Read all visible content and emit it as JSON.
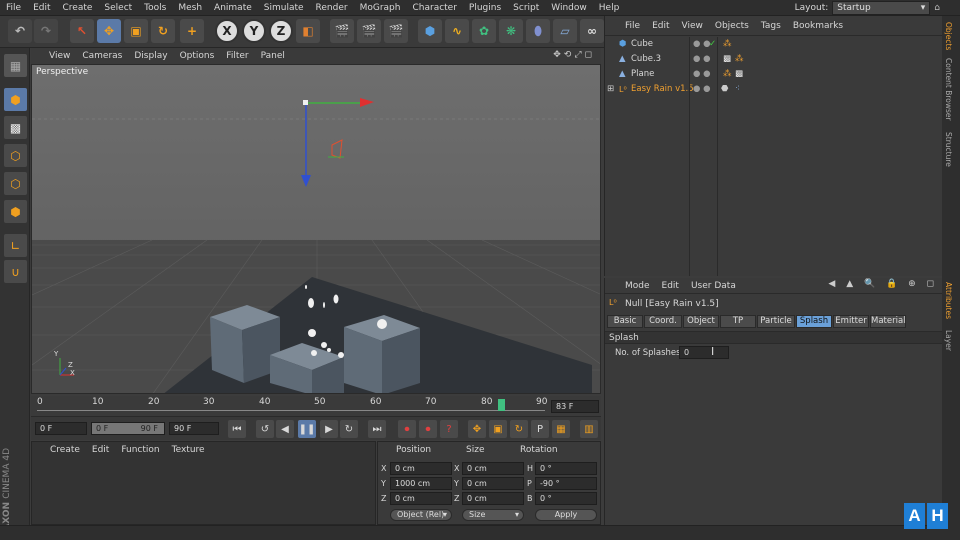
{
  "menubar": {
    "items": [
      "File",
      "Edit",
      "Create",
      "Select",
      "Tools",
      "Mesh",
      "Animate",
      "Simulate",
      "Render",
      "MoGraph",
      "Character",
      "Plugins",
      "Script",
      "Window",
      "Help"
    ],
    "layout_label": "Layout:",
    "layout_value": "Startup"
  },
  "toolbar": {
    "axis_x": "X",
    "axis_y": "Y",
    "axis_z": "Z"
  },
  "viewport": {
    "menu": [
      "View",
      "Cameras",
      "Display",
      "Options",
      "Filter",
      "Panel"
    ],
    "label": "Perspective",
    "axis_labels": {
      "y": "Y",
      "x": "X",
      "z": "Z"
    }
  },
  "timeline": {
    "ticks": [
      "0",
      "10",
      "20",
      "30",
      "40",
      "50",
      "60",
      "70",
      "80",
      "90"
    ],
    "current_frame": "83 F"
  },
  "playbar": {
    "start_frame": "0 F",
    "range_min": "0 F",
    "range_max": "90 F",
    "end_frame": "90 F"
  },
  "material_panel": {
    "menu": [
      "Create",
      "Edit",
      "Function",
      "Texture"
    ]
  },
  "coord_panel": {
    "headers": [
      "Position",
      "Size",
      "Rotation"
    ],
    "rows": [
      {
        "pl": "X",
        "pv": "0 cm",
        "sl": "X",
        "sv": "0 cm",
        "rl": "H",
        "rv": "0 °"
      },
      {
        "pl": "Y",
        "pv": "1000 cm",
        "sl": "Y",
        "sv": "0 cm",
        "rl": "P",
        "rv": "-90 °"
      },
      {
        "pl": "Z",
        "pv": "0 cm",
        "sl": "Z",
        "sv": "0 cm",
        "rl": "B",
        "rv": "0 °"
      }
    ],
    "mode_select": "Object (Rel)",
    "size_select": "Size",
    "apply_label": "Apply"
  },
  "object_panel": {
    "menu": [
      "File",
      "Edit",
      "View",
      "Objects",
      "Tags",
      "Bookmarks"
    ],
    "objects": [
      {
        "name": "Cube",
        "color": "#d8d8d8"
      },
      {
        "name": "Cube.3",
        "color": "#d8d8d8"
      },
      {
        "name": "Plane",
        "color": "#d8d8d8"
      },
      {
        "name": "Easy Rain v1.5",
        "color": "#f0a030"
      }
    ]
  },
  "attr_panel": {
    "menu": [
      "Mode",
      "Edit",
      "User Data"
    ],
    "object_title": "Null [Easy Rain v1.5]",
    "tabs": [
      "Basic",
      "Coord.",
      "Object",
      "TP",
      "Particle",
      "Splash",
      "Emitter",
      "Material"
    ],
    "active_tab": "Splash",
    "section_title": "Splash",
    "field_label": "No. of Splashes",
    "field_value": "0"
  },
  "side_tabs": [
    "Objects",
    "Content Browser",
    "Structure",
    "Attributes",
    "Layer"
  ],
  "brand": {
    "maxon": "MAXON",
    "cinema": "CINEMA 4D"
  },
  "watermark": {
    "a": "A",
    "h": "H"
  },
  "colors": {
    "accent": "#6aa0d8",
    "highlight_orange": "#f0a030",
    "badge_blue": "#1f7fd6"
  }
}
